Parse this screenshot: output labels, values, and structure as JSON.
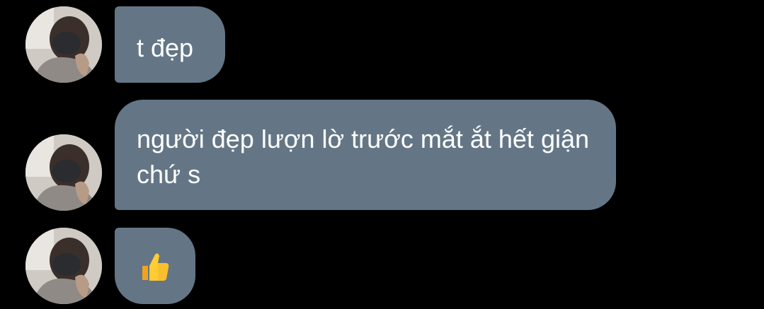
{
  "messages": [
    {
      "text": "t đẹp",
      "avatar_icon": "user-avatar-photo"
    },
    {
      "text": "người đẹp lượn lờ trước mắt ắt hết giận chứ s",
      "avatar_icon": "user-avatar-photo"
    },
    {
      "text": "",
      "emoji": "thumbs-up-icon",
      "avatar_icon": "user-avatar-photo"
    }
  ],
  "colors": {
    "background": "#000000",
    "bubble": "#647686",
    "text": "#ffffff"
  }
}
